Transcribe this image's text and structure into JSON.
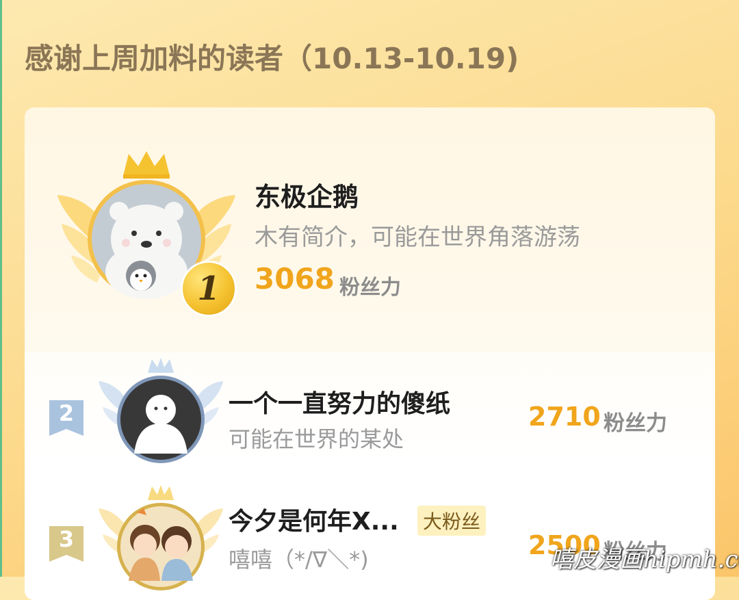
{
  "page": {
    "title": "感谢上周加料的读者（10.13-10.19)"
  },
  "colors": {
    "accent_score": "#f0a51c",
    "background_top": "#fde9b0",
    "background_bottom": "#fbc56a",
    "rank2_badge": "#a9c2de",
    "rank3_badge": "#d8c88a",
    "crown_gold": "#f5c230"
  },
  "top_reader": {
    "rank": "1",
    "name": "东极企鹅",
    "bio": "木有简介，可能在世界角落游荡",
    "score": "3068",
    "score_unit": "粉丝力",
    "avatar_icon": "polar-bear-penguin-avatar"
  },
  "ranking": [
    {
      "rank": "2",
      "name": "一个一直努力的傻纸",
      "bio": "可能在世界的某处",
      "score": "2710",
      "score_unit": "粉丝力",
      "avatar_icon": "ghost-figure-avatar"
    },
    {
      "rank": "3",
      "name": "今夕是何年X...",
      "tag": "大粉丝",
      "bio": "嘻嘻（*/∇＼*)",
      "score": "2500",
      "score_unit": "粉丝力",
      "avatar_icon": "cartoon-kids-avatar"
    }
  ],
  "watermark": {
    "text": "嘻皮漫画hipmh.com"
  }
}
